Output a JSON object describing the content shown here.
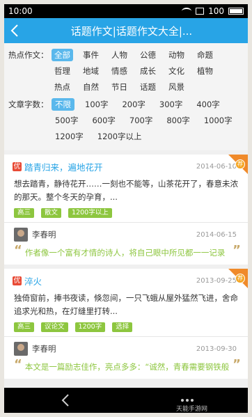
{
  "status": {
    "time": "10:00",
    "battery": "100"
  },
  "header": {
    "title": "话题作文|话题作文大全|..."
  },
  "filters": {
    "topic_label": "热点作文：",
    "topics": [
      "全部",
      "事件",
      "人物",
      "公德",
      "动物",
      "命题",
      "哲理",
      "地域",
      "情感",
      "成长",
      "文化",
      "植物",
      "热点",
      "自然",
      "节日",
      "话题",
      "风景"
    ],
    "topic_selected": 0,
    "wordcount_label": "文章字数：",
    "wordcounts": [
      "不限",
      "100字",
      "200字",
      "300字",
      "400字",
      "500字",
      "600字",
      "700字",
      "800字",
      "1000字",
      "1200字",
      "1200字以上"
    ],
    "wordcount_selected": 0
  },
  "articles": [
    {
      "badge": "优",
      "title": "踏青归来，遍地花开",
      "date": "2014-06-10",
      "ribbon": "荐",
      "excerpt": "想去踏青，静待花开……一刻也不能等，山茶花开了，春意未浓的那天。整个冬天的孕育，...",
      "tags": [
        "高三",
        "散文",
        "1200字以上"
      ],
      "author": "李春明",
      "author_date": "2014-06-15",
      "comment": "作者像一个富有才情的诗人，将自己眼中所见都一一记录"
    },
    {
      "badge": "优",
      "title": "淬火",
      "date": "2013-09-25",
      "ribbon": "荐",
      "excerpt": "独倚窗前，捧书夜读，倏忽间，一只飞蛾从屋外猛然飞进，舍命追求光和热，在灯缝里打转...",
      "tags": [
        "高三",
        "议论文",
        "1200字",
        "选择"
      ],
      "author": "李春明",
      "author_date": "2013-09-30",
      "comment": "本文是一篇励志佳作，亮点多多：“诚然，青春需要钢铁般"
    }
  ],
  "watermark": "天能手游网"
}
